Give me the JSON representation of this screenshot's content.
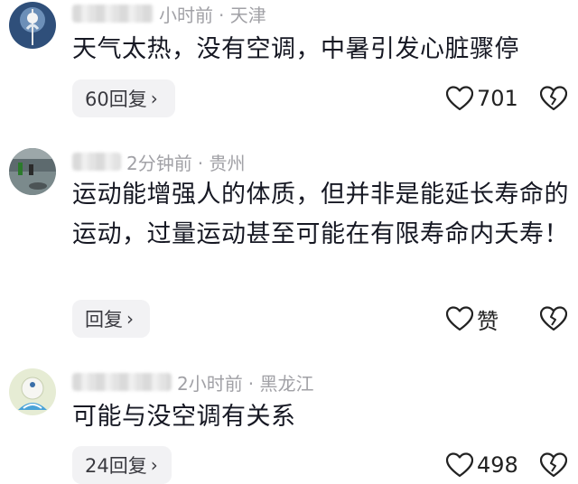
{
  "comments": [
    {
      "time": "小时前",
      "location": "· 天津",
      "text": "天气太热，没有空调，中暑引发心脏骤停",
      "reply_label": "60回复",
      "reply_chevron": "›",
      "likes": "701",
      "like_icon": "heart-outline-icon",
      "dislike_icon": "broken-heart-icon"
    },
    {
      "time": "2分钟前",
      "location": "· 贵州",
      "text": "运动能增强人的体质，但并非是能延长寿命的运动，过量运动甚至可能在有限寿命内夭寿！",
      "reply_label": "回复",
      "reply_chevron": "›",
      "likes": "赞",
      "like_icon": "heart-outline-icon",
      "dislike_icon": "broken-heart-icon"
    },
    {
      "time": "2小时前",
      "location": "· 黑龙江",
      "text": "可能与没空调有关系",
      "reply_label": "24回复",
      "reply_chevron": "›",
      "likes": "498",
      "like_icon": "heart-outline-icon",
      "dislike_icon": "broken-heart-icon"
    }
  ],
  "colors": {
    "text": "#161823",
    "meta": "#a1a1a6",
    "reply_bg": "#f2f2f4"
  }
}
